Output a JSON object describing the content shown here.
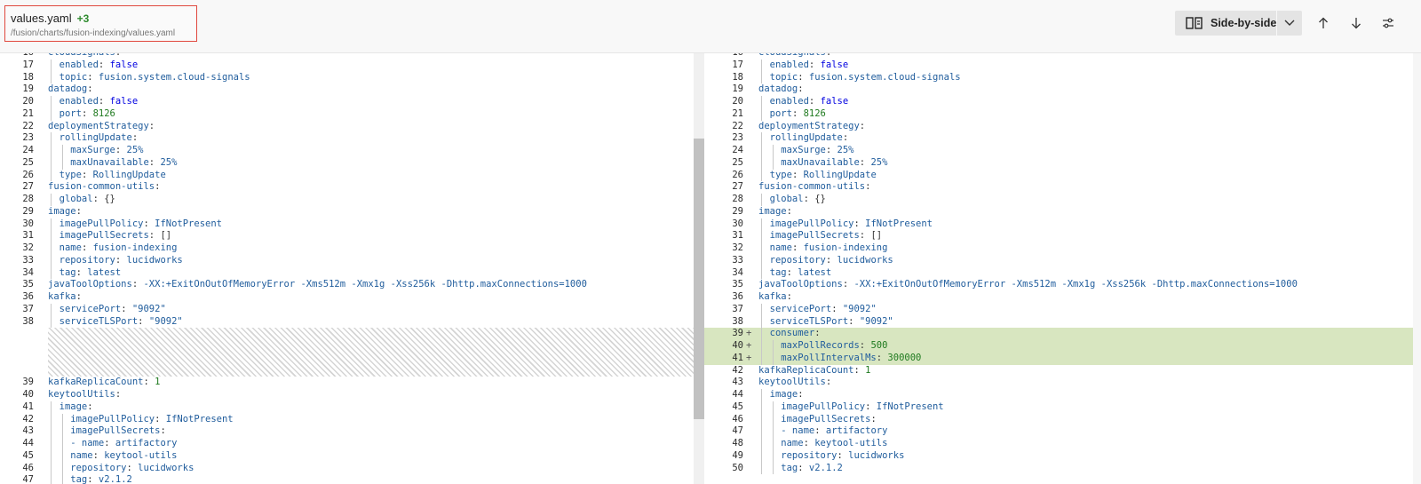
{
  "header": {
    "file_name": "values.yaml",
    "add_count": "+3",
    "file_path": "/fusion/charts/fusion-indexing/values.yaml",
    "view_mode": "Side-by-side"
  },
  "icons": {
    "view_mode": "side-by-side-icon",
    "dropdown": "chevron-down-icon",
    "prev": "arrow-up-icon",
    "next": "arrow-down-icon",
    "more": "options-icon"
  },
  "colors": {
    "added_bg": "#d8e6c0",
    "highlight_border": "#e0483e"
  },
  "left_lines": [
    {
      "n": "16",
      "t": [
        [
          "cloudSignals",
          "k"
        ],
        [
          ":",
          "p"
        ]
      ]
    },
    {
      "n": "17",
      "t": [
        [
          "  enabled",
          "k"
        ],
        [
          ": ",
          "p"
        ],
        [
          "false",
          "vb"
        ]
      ]
    },
    {
      "n": "18",
      "t": [
        [
          "  topic",
          "k"
        ],
        [
          ": ",
          "p"
        ],
        [
          "fusion.system.cloud-signals",
          "vs"
        ]
      ]
    },
    {
      "n": "19",
      "t": [
        [
          "datadog",
          "k"
        ],
        [
          ":",
          "p"
        ]
      ]
    },
    {
      "n": "20",
      "t": [
        [
          "  enabled",
          "k"
        ],
        [
          ": ",
          "p"
        ],
        [
          "false",
          "vb"
        ]
      ]
    },
    {
      "n": "21",
      "t": [
        [
          "  port",
          "k"
        ],
        [
          ": ",
          "p"
        ],
        [
          "8126",
          "vn"
        ]
      ]
    },
    {
      "n": "22",
      "t": [
        [
          "deploymentStrategy",
          "k"
        ],
        [
          ":",
          "p"
        ]
      ]
    },
    {
      "n": "23",
      "t": [
        [
          "  rollingUpdate",
          "k"
        ],
        [
          ":",
          "p"
        ]
      ]
    },
    {
      "n": "24",
      "t": [
        [
          "    maxSurge",
          "k"
        ],
        [
          ": ",
          "p"
        ],
        [
          "25%",
          "vs"
        ]
      ]
    },
    {
      "n": "25",
      "t": [
        [
          "    maxUnavailable",
          "k"
        ],
        [
          ": ",
          "p"
        ],
        [
          "25%",
          "vs"
        ]
      ]
    },
    {
      "n": "26",
      "t": [
        [
          "  type",
          "k"
        ],
        [
          ": ",
          "p"
        ],
        [
          "RollingUpdate",
          "vs"
        ]
      ]
    },
    {
      "n": "27",
      "t": [
        [
          "fusion-common-utils",
          "k"
        ],
        [
          ":",
          "p"
        ]
      ]
    },
    {
      "n": "28",
      "t": [
        [
          "  global",
          "k"
        ],
        [
          ": ",
          "p"
        ],
        [
          "{}",
          "p"
        ]
      ]
    },
    {
      "n": "29",
      "t": [
        [
          "image",
          "k"
        ],
        [
          ":",
          "p"
        ]
      ]
    },
    {
      "n": "30",
      "t": [
        [
          "  imagePullPolicy",
          "k"
        ],
        [
          ": ",
          "p"
        ],
        [
          "IfNotPresent",
          "vs"
        ]
      ]
    },
    {
      "n": "31",
      "t": [
        [
          "  imagePullSecrets",
          "k"
        ],
        [
          ": ",
          "p"
        ],
        [
          "[]",
          "p"
        ]
      ]
    },
    {
      "n": "32",
      "t": [
        [
          "  name",
          "k"
        ],
        [
          ": ",
          "p"
        ],
        [
          "fusion-indexing",
          "vs"
        ]
      ]
    },
    {
      "n": "33",
      "t": [
        [
          "  repository",
          "k"
        ],
        [
          ": ",
          "p"
        ],
        [
          "lucidworks",
          "vs"
        ]
      ]
    },
    {
      "n": "34",
      "t": [
        [
          "  tag",
          "k"
        ],
        [
          ": ",
          "p"
        ],
        [
          "latest",
          "vs"
        ]
      ]
    },
    {
      "n": "35",
      "t": [
        [
          "javaToolOptions",
          "k"
        ],
        [
          ": ",
          "p"
        ],
        [
          "-XX:+ExitOnOutOfMemoryError -Xms512m -Xmx1g -Xss256k -Dhttp.maxConnections=1000",
          "vs"
        ]
      ]
    },
    {
      "n": "36",
      "t": [
        [
          "kafka",
          "k"
        ],
        [
          ":",
          "p"
        ]
      ]
    },
    {
      "n": "37",
      "t": [
        [
          "  servicePort",
          "k"
        ],
        [
          ": ",
          "p"
        ],
        [
          "\"9092\"",
          "vs"
        ]
      ]
    },
    {
      "n": "38",
      "t": [
        [
          "  serviceTLSPort",
          "k"
        ],
        [
          ": ",
          "p"
        ],
        [
          "\"9092\"",
          "vs"
        ]
      ]
    },
    {
      "gap": true
    },
    {
      "n": "39",
      "t": [
        [
          "kafkaReplicaCount",
          "k"
        ],
        [
          ": ",
          "p"
        ],
        [
          "1",
          "vn"
        ]
      ]
    },
    {
      "n": "40",
      "t": [
        [
          "keytoolUtils",
          "k"
        ],
        [
          ":",
          "p"
        ]
      ]
    },
    {
      "n": "41",
      "t": [
        [
          "  image",
          "k"
        ],
        [
          ":",
          "p"
        ]
      ]
    },
    {
      "n": "42",
      "t": [
        [
          "    imagePullPolicy",
          "k"
        ],
        [
          ": ",
          "p"
        ],
        [
          "IfNotPresent",
          "vs"
        ]
      ]
    },
    {
      "n": "43",
      "t": [
        [
          "    imagePullSecrets",
          "k"
        ],
        [
          ":",
          "p"
        ]
      ]
    },
    {
      "n": "44",
      "t": [
        [
          "    - name",
          "k"
        ],
        [
          ": ",
          "p"
        ],
        [
          "artifactory",
          "vs"
        ]
      ]
    },
    {
      "n": "45",
      "t": [
        [
          "    name",
          "k"
        ],
        [
          ": ",
          "p"
        ],
        [
          "keytool-utils",
          "vs"
        ]
      ]
    },
    {
      "n": "46",
      "t": [
        [
          "    repository",
          "k"
        ],
        [
          ": ",
          "p"
        ],
        [
          "lucidworks",
          "vs"
        ]
      ]
    },
    {
      "n": "47",
      "t": [
        [
          "    tag",
          "k"
        ],
        [
          ": ",
          "p"
        ],
        [
          "v2.1.2",
          "vs"
        ]
      ]
    }
  ],
  "right_lines": [
    {
      "n": "16",
      "t": [
        [
          "cloudSignals",
          "k"
        ],
        [
          ":",
          "p"
        ]
      ]
    },
    {
      "n": "17",
      "t": [
        [
          "  enabled",
          "k"
        ],
        [
          ": ",
          "p"
        ],
        [
          "false",
          "vb"
        ]
      ]
    },
    {
      "n": "18",
      "t": [
        [
          "  topic",
          "k"
        ],
        [
          ": ",
          "p"
        ],
        [
          "fusion.system.cloud-signals",
          "vs"
        ]
      ]
    },
    {
      "n": "19",
      "t": [
        [
          "datadog",
          "k"
        ],
        [
          ":",
          "p"
        ]
      ]
    },
    {
      "n": "20",
      "t": [
        [
          "  enabled",
          "k"
        ],
        [
          ": ",
          "p"
        ],
        [
          "false",
          "vb"
        ]
      ]
    },
    {
      "n": "21",
      "t": [
        [
          "  port",
          "k"
        ],
        [
          ": ",
          "p"
        ],
        [
          "8126",
          "vn"
        ]
      ]
    },
    {
      "n": "22",
      "t": [
        [
          "deploymentStrategy",
          "k"
        ],
        [
          ":",
          "p"
        ]
      ]
    },
    {
      "n": "23",
      "t": [
        [
          "  rollingUpdate",
          "k"
        ],
        [
          ":",
          "p"
        ]
      ]
    },
    {
      "n": "24",
      "t": [
        [
          "    maxSurge",
          "k"
        ],
        [
          ": ",
          "p"
        ],
        [
          "25%",
          "vs"
        ]
      ]
    },
    {
      "n": "25",
      "t": [
        [
          "    maxUnavailable",
          "k"
        ],
        [
          ": ",
          "p"
        ],
        [
          "25%",
          "vs"
        ]
      ]
    },
    {
      "n": "26",
      "t": [
        [
          "  type",
          "k"
        ],
        [
          ": ",
          "p"
        ],
        [
          "RollingUpdate",
          "vs"
        ]
      ]
    },
    {
      "n": "27",
      "t": [
        [
          "fusion-common-utils",
          "k"
        ],
        [
          ":",
          "p"
        ]
      ]
    },
    {
      "n": "28",
      "t": [
        [
          "  global",
          "k"
        ],
        [
          ": ",
          "p"
        ],
        [
          "{}",
          "p"
        ]
      ]
    },
    {
      "n": "29",
      "t": [
        [
          "image",
          "k"
        ],
        [
          ":",
          "p"
        ]
      ]
    },
    {
      "n": "30",
      "t": [
        [
          "  imagePullPolicy",
          "k"
        ],
        [
          ": ",
          "p"
        ],
        [
          "IfNotPresent",
          "vs"
        ]
      ]
    },
    {
      "n": "31",
      "t": [
        [
          "  imagePullSecrets",
          "k"
        ],
        [
          ": ",
          "p"
        ],
        [
          "[]",
          "p"
        ]
      ]
    },
    {
      "n": "32",
      "t": [
        [
          "  name",
          "k"
        ],
        [
          ": ",
          "p"
        ],
        [
          "fusion-indexing",
          "vs"
        ]
      ]
    },
    {
      "n": "33",
      "t": [
        [
          "  repository",
          "k"
        ],
        [
          ": ",
          "p"
        ],
        [
          "lucidworks",
          "vs"
        ]
      ]
    },
    {
      "n": "34",
      "t": [
        [
          "  tag",
          "k"
        ],
        [
          ": ",
          "p"
        ],
        [
          "latest",
          "vs"
        ]
      ]
    },
    {
      "n": "35",
      "t": [
        [
          "javaToolOptions",
          "k"
        ],
        [
          ": ",
          "p"
        ],
        [
          "-XX:+ExitOnOutOfMemoryError -Xms512m -Xmx1g -Xss256k -Dhttp.maxConnections=1000",
          "vs"
        ]
      ]
    },
    {
      "n": "36",
      "t": [
        [
          "kafka",
          "k"
        ],
        [
          ":",
          "p"
        ]
      ]
    },
    {
      "n": "37",
      "t": [
        [
          "  servicePort",
          "k"
        ],
        [
          ": ",
          "p"
        ],
        [
          "\"9092\"",
          "vs"
        ]
      ]
    },
    {
      "n": "38",
      "t": [
        [
          "  serviceTLSPort",
          "k"
        ],
        [
          ": ",
          "p"
        ],
        [
          "\"9092\"",
          "vs"
        ]
      ]
    },
    {
      "n": "39",
      "added": true,
      "t": [
        [
          "  consumer",
          "k"
        ],
        [
          ":",
          "p"
        ]
      ]
    },
    {
      "n": "40",
      "added": true,
      "t": [
        [
          "    maxPollRecords",
          "k"
        ],
        [
          ": ",
          "p"
        ],
        [
          "500",
          "vn"
        ]
      ]
    },
    {
      "n": "41",
      "added": true,
      "t": [
        [
          "    maxPollIntervalMs",
          "k"
        ],
        [
          ": ",
          "p"
        ],
        [
          "300000",
          "vn"
        ]
      ]
    },
    {
      "n": "42",
      "t": [
        [
          "kafkaReplicaCount",
          "k"
        ],
        [
          ": ",
          "p"
        ],
        [
          "1",
          "vn"
        ]
      ]
    },
    {
      "n": "43",
      "t": [
        [
          "keytoolUtils",
          "k"
        ],
        [
          ":",
          "p"
        ]
      ]
    },
    {
      "n": "44",
      "t": [
        [
          "  image",
          "k"
        ],
        [
          ":",
          "p"
        ]
      ]
    },
    {
      "n": "45",
      "t": [
        [
          "    imagePullPolicy",
          "k"
        ],
        [
          ": ",
          "p"
        ],
        [
          "IfNotPresent",
          "vs"
        ]
      ]
    },
    {
      "n": "46",
      "t": [
        [
          "    imagePullSecrets",
          "k"
        ],
        [
          ":",
          "p"
        ]
      ]
    },
    {
      "n": "47",
      "t": [
        [
          "    - name",
          "k"
        ],
        [
          ": ",
          "p"
        ],
        [
          "artifactory",
          "vs"
        ]
      ]
    },
    {
      "n": "48",
      "t": [
        [
          "    name",
          "k"
        ],
        [
          ": ",
          "p"
        ],
        [
          "keytool-utils",
          "vs"
        ]
      ]
    },
    {
      "n": "49",
      "t": [
        [
          "    repository",
          "k"
        ],
        [
          ": ",
          "p"
        ],
        [
          "lucidworks",
          "vs"
        ]
      ]
    },
    {
      "n": "50",
      "t": [
        [
          "    tag",
          "k"
        ],
        [
          ": ",
          "p"
        ],
        [
          "v2.1.2",
          "vs"
        ]
      ]
    }
  ]
}
